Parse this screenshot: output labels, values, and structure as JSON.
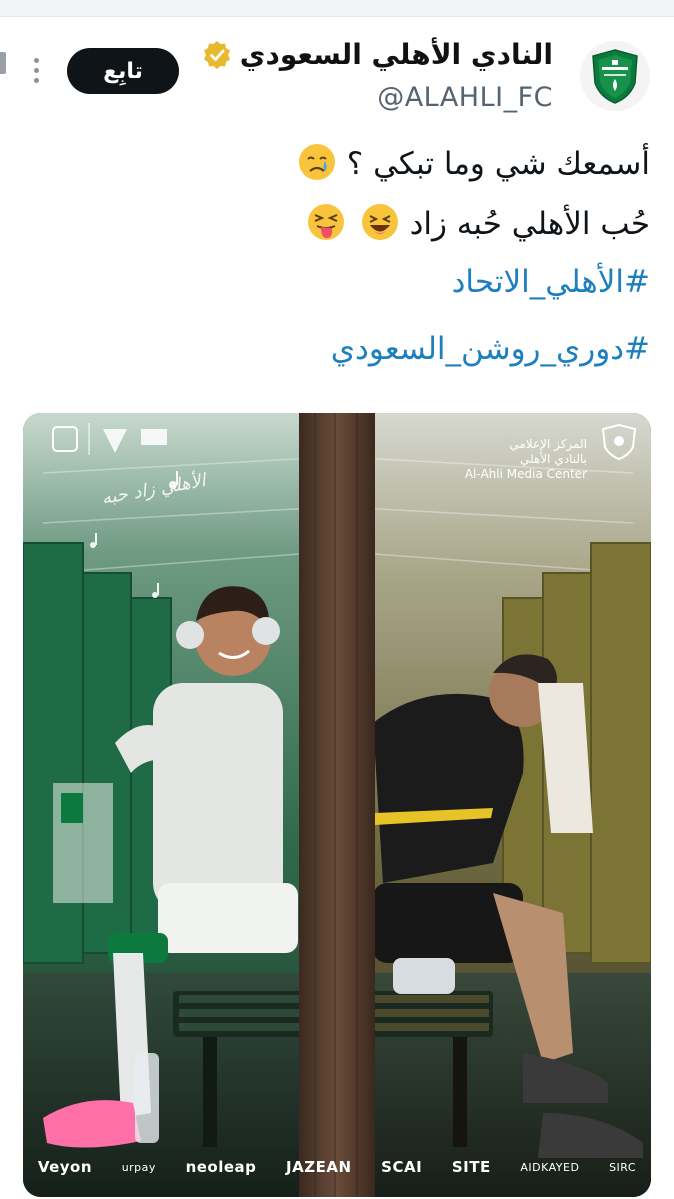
{
  "account": {
    "name": "النادي الأهلي السعودي",
    "handle": "@ALAHLI_FC",
    "follow_label": "تابِع"
  },
  "tweet": {
    "line1": "أسمعك شي وما تبكي ؟",
    "line2": "حُب الأهلي حُبه زاد",
    "hashtag1": "#الأهلي_الاتحاد",
    "hashtag2": "#دوري_روشن_السعودي"
  },
  "media": {
    "media_center_ar": "المركز الإعلامي",
    "media_center_club_ar": "بالنادي الأهلي",
    "media_center_en": "Al-Ahli Media Center",
    "lyric": "الأهلي زاد حبه",
    "sponsors": [
      "Veyon",
      "urpay",
      "neoleap",
      "JAZEAN",
      "SCAI",
      "SITE",
      "AIDKAYED",
      "SIRC"
    ]
  },
  "colors": {
    "hashtag": "#1d7fbf",
    "follow_bg": "#0f1419",
    "verified": "#e8b92f",
    "club_green": "#0b7a3c"
  },
  "icons": [
    "verified-badge-icon",
    "more-options-icon",
    "crying-face-emoji",
    "laughing-face-emoji",
    "squinting-tongue-emoji"
  ]
}
